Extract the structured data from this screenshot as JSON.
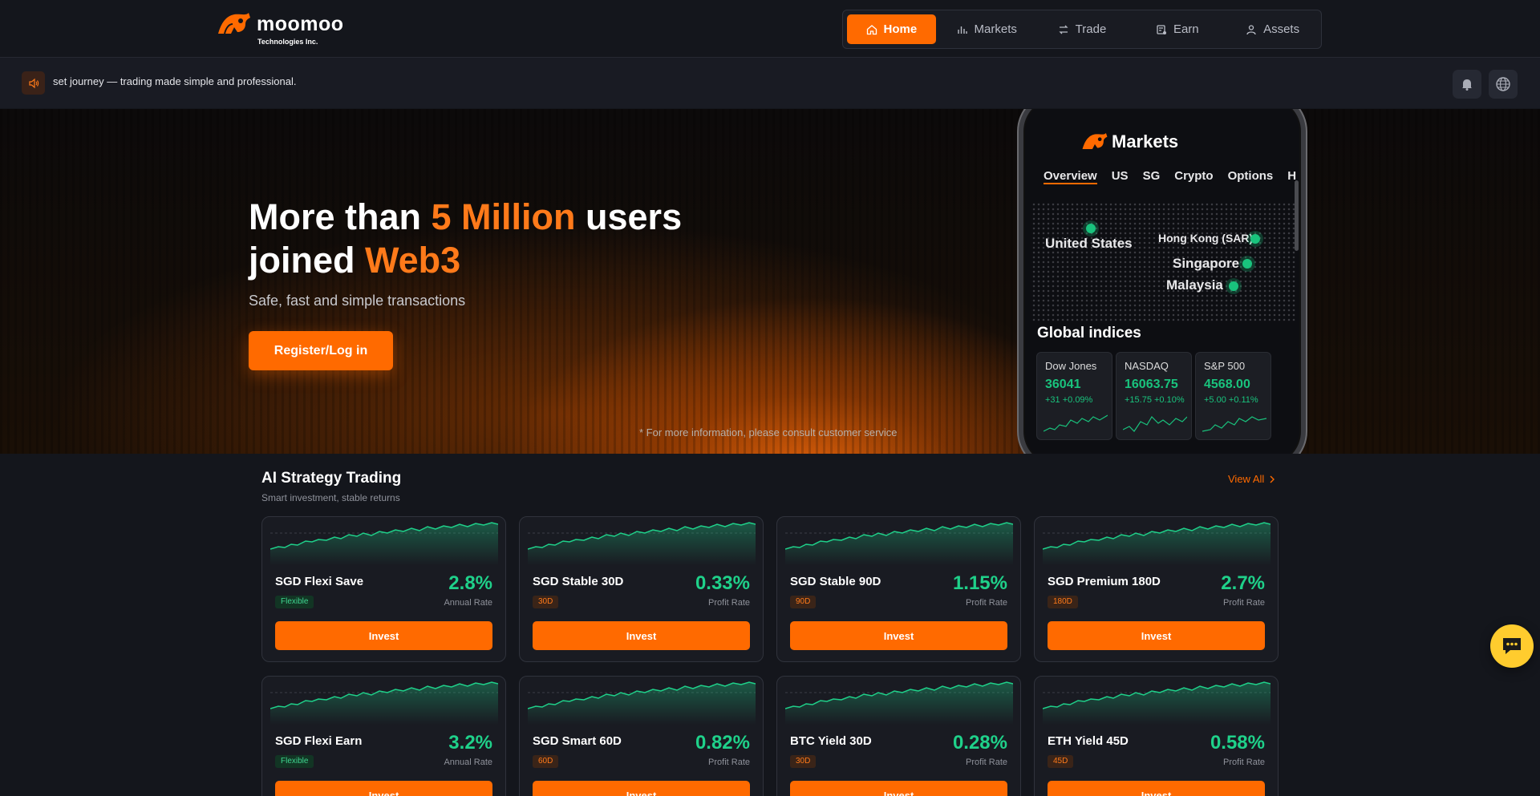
{
  "brand": {
    "name": "moomoo",
    "subtitle": "Technologies Inc.",
    "color": "#ff6a00"
  },
  "nav": [
    {
      "label": "Home",
      "icon": "home-icon",
      "active": true
    },
    {
      "label": "Markets",
      "icon": "bar-chart-icon",
      "active": false
    },
    {
      "label": "Trade",
      "icon": "swap-icon",
      "active": false
    },
    {
      "label": "Earn",
      "icon": "wallet-icon",
      "active": false
    },
    {
      "label": "Assets",
      "icon": "user-icon",
      "active": false
    }
  ],
  "announcement": {
    "text": "set journey — trading made simple and professional.",
    "icon": "speaker-icon"
  },
  "header_actions": [
    {
      "icon": "bell-icon"
    },
    {
      "icon": "globe-icon"
    }
  ],
  "hero": {
    "title_part1": "More than ",
    "title_highlight1": "5 Million",
    "title_part2": " users",
    "title_part3": "joined ",
    "title_highlight2": "Web3",
    "subtitle": "Safe, fast and simple transactions",
    "cta": "Register/Log in",
    "disclaimer": "* For more information, please consult customer service"
  },
  "phone": {
    "title": "Markets",
    "tabs": [
      "Overview",
      "US",
      "SG",
      "Crypto",
      "Options",
      "H"
    ],
    "regions": [
      "United States",
      "Hong Kong (SAR)",
      "Singapore",
      "Malaysia"
    ],
    "global_indices_label": "Global indices",
    "indices": [
      {
        "name": "Dow Jones",
        "value": "36041",
        "change": "+31 +0.09%"
      },
      {
        "name": "NASDAQ",
        "value": "16063.75",
        "change": "+15.75 +0.10%"
      },
      {
        "name": "S&P 500",
        "value": "4568.00",
        "change": "+5.00 +0.11%"
      }
    ]
  },
  "section": {
    "title": "AI Strategy Trading",
    "subtitle": "Smart investment, stable returns",
    "view_all": "View All"
  },
  "products": [
    {
      "name": "SGD Flexi Save",
      "badge": "Flexible",
      "badge_type": "flex",
      "rate": "2.8%",
      "rate_label": "Annual Rate",
      "action": "Invest"
    },
    {
      "name": "SGD Stable 30D",
      "badge": "30D",
      "badge_type": "term",
      "rate": "0.33%",
      "rate_label": "Profit Rate",
      "action": "Invest"
    },
    {
      "name": "SGD Stable 90D",
      "badge": "90D",
      "badge_type": "term",
      "rate": "1.15%",
      "rate_label": "Profit Rate",
      "action": "Invest"
    },
    {
      "name": "SGD Premium 180D",
      "badge": "180D",
      "badge_type": "term",
      "rate": "2.7%",
      "rate_label": "Profit Rate",
      "action": "Invest"
    },
    {
      "name": "SGD Flexi Earn",
      "badge": "Flexible",
      "badge_type": "flex",
      "rate": "3.2%",
      "rate_label": "Annual Rate",
      "action": "Invest"
    },
    {
      "name": "SGD Smart 60D",
      "badge": "60D",
      "badge_type": "term",
      "rate": "0.82%",
      "rate_label": "Profit Rate",
      "action": "Invest"
    },
    {
      "name": "BTC Yield 30D",
      "badge": "30D",
      "badge_type": "term",
      "rate": "0.28%",
      "rate_label": "Profit Rate",
      "action": "Invest"
    },
    {
      "name": "ETH Yield 45D",
      "badge": "45D",
      "badge_type": "term",
      "rate": "0.58%",
      "rate_label": "Profit Rate",
      "action": "Invest"
    }
  ],
  "colors": {
    "accent": "#ff6a00",
    "positive": "#1fd18a",
    "chat": "#ffcc2e"
  },
  "chat": {
    "icon": "chat-icon"
  }
}
